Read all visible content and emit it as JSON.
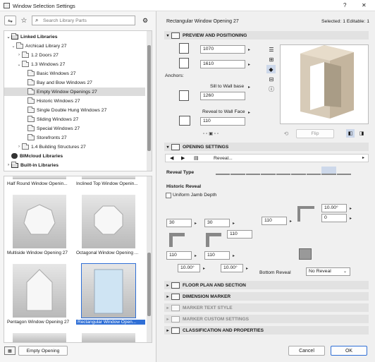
{
  "window": {
    "title": "Window Selection Settings",
    "help": "?",
    "close": "✕"
  },
  "left": {
    "search_placeholder": "Search Library Parts",
    "tree": [
      {
        "label": "Linked Libraries",
        "bold": true
      },
      {
        "label": "Archicad Library 27"
      },
      {
        "label": "1.2 Doors 27"
      },
      {
        "label": "1.3 Windows 27"
      },
      {
        "label": "Basic Windows 27"
      },
      {
        "label": "Bay and Bow Windows 27"
      },
      {
        "label": "Empty Window Openings 27"
      },
      {
        "label": "Historic Windows 27"
      },
      {
        "label": "Single Double Hung Windows 27"
      },
      {
        "label": "Sliding Windows 27"
      },
      {
        "label": "Special Windows 27"
      },
      {
        "label": "Storefronts 27"
      },
      {
        "label": "1.4 Building Structures 27"
      },
      {
        "label": "BIMcloud Libraries",
        "bold": true
      },
      {
        "label": "Built-in Libraries",
        "bold": true
      }
    ],
    "thumbs": [
      {
        "label": "Half Round Window Openin..."
      },
      {
        "label": "Inclined Top Window Openin..."
      },
      {
        "label": "Multiside Window Opening 27"
      },
      {
        "label": "Octagonal Window Opening ..."
      },
      {
        "label": "Pentagon Window Opening 27"
      },
      {
        "label": "Rectangular Window Open..."
      }
    ],
    "empty_opening_label": "Empty Opening"
  },
  "right": {
    "part_name": "Rectangular Window Opening 27",
    "selected_info": "Selected: 1 Editable: 1",
    "preview": {
      "header": "PREVIEW AND POSITIONING",
      "width": "1070",
      "height": "1610",
      "anchors_label": "Anchors:",
      "anchor_mode": "Sill to Wall base",
      "sill": "1260",
      "reveal_mode": "Reveal to Wall Face",
      "reveal": "110",
      "flip_label": "Flip"
    },
    "opening": {
      "header": "OPENING SETTINGS",
      "panel": "Reveal...",
      "reveal_type_label": "Reveal Type",
      "historic_reveal_label": "Historic Reveal",
      "uniform_jamb": "Uniform Jamb Depth",
      "v1": "30",
      "v2": "30",
      "v3": "110",
      "v4": "110",
      "v5": "110",
      "v6": "110",
      "v7": "10.00°",
      "v8": "0",
      "v9": "10.00°",
      "v10": "10.00°",
      "bottom_reveal_label": "Bottom Reveal",
      "bottom_reveal_value": "No Reveal"
    },
    "sections": [
      {
        "label": "FLOOR PLAN AND SECTION",
        "dim": false
      },
      {
        "label": "DIMENSION MARKER",
        "dim": false
      },
      {
        "label": "MARKER TEXT STYLE",
        "dim": true
      },
      {
        "label": "MARKER CUSTOM SETTINGS",
        "dim": true
      },
      {
        "label": "CLASSIFICATION AND PROPERTIES",
        "dim": false
      }
    ],
    "cancel": "Cancel",
    "ok": "OK"
  },
  "colors": {
    "accent": "#2f6fd6",
    "selected_row": "#dcdcdc"
  }
}
